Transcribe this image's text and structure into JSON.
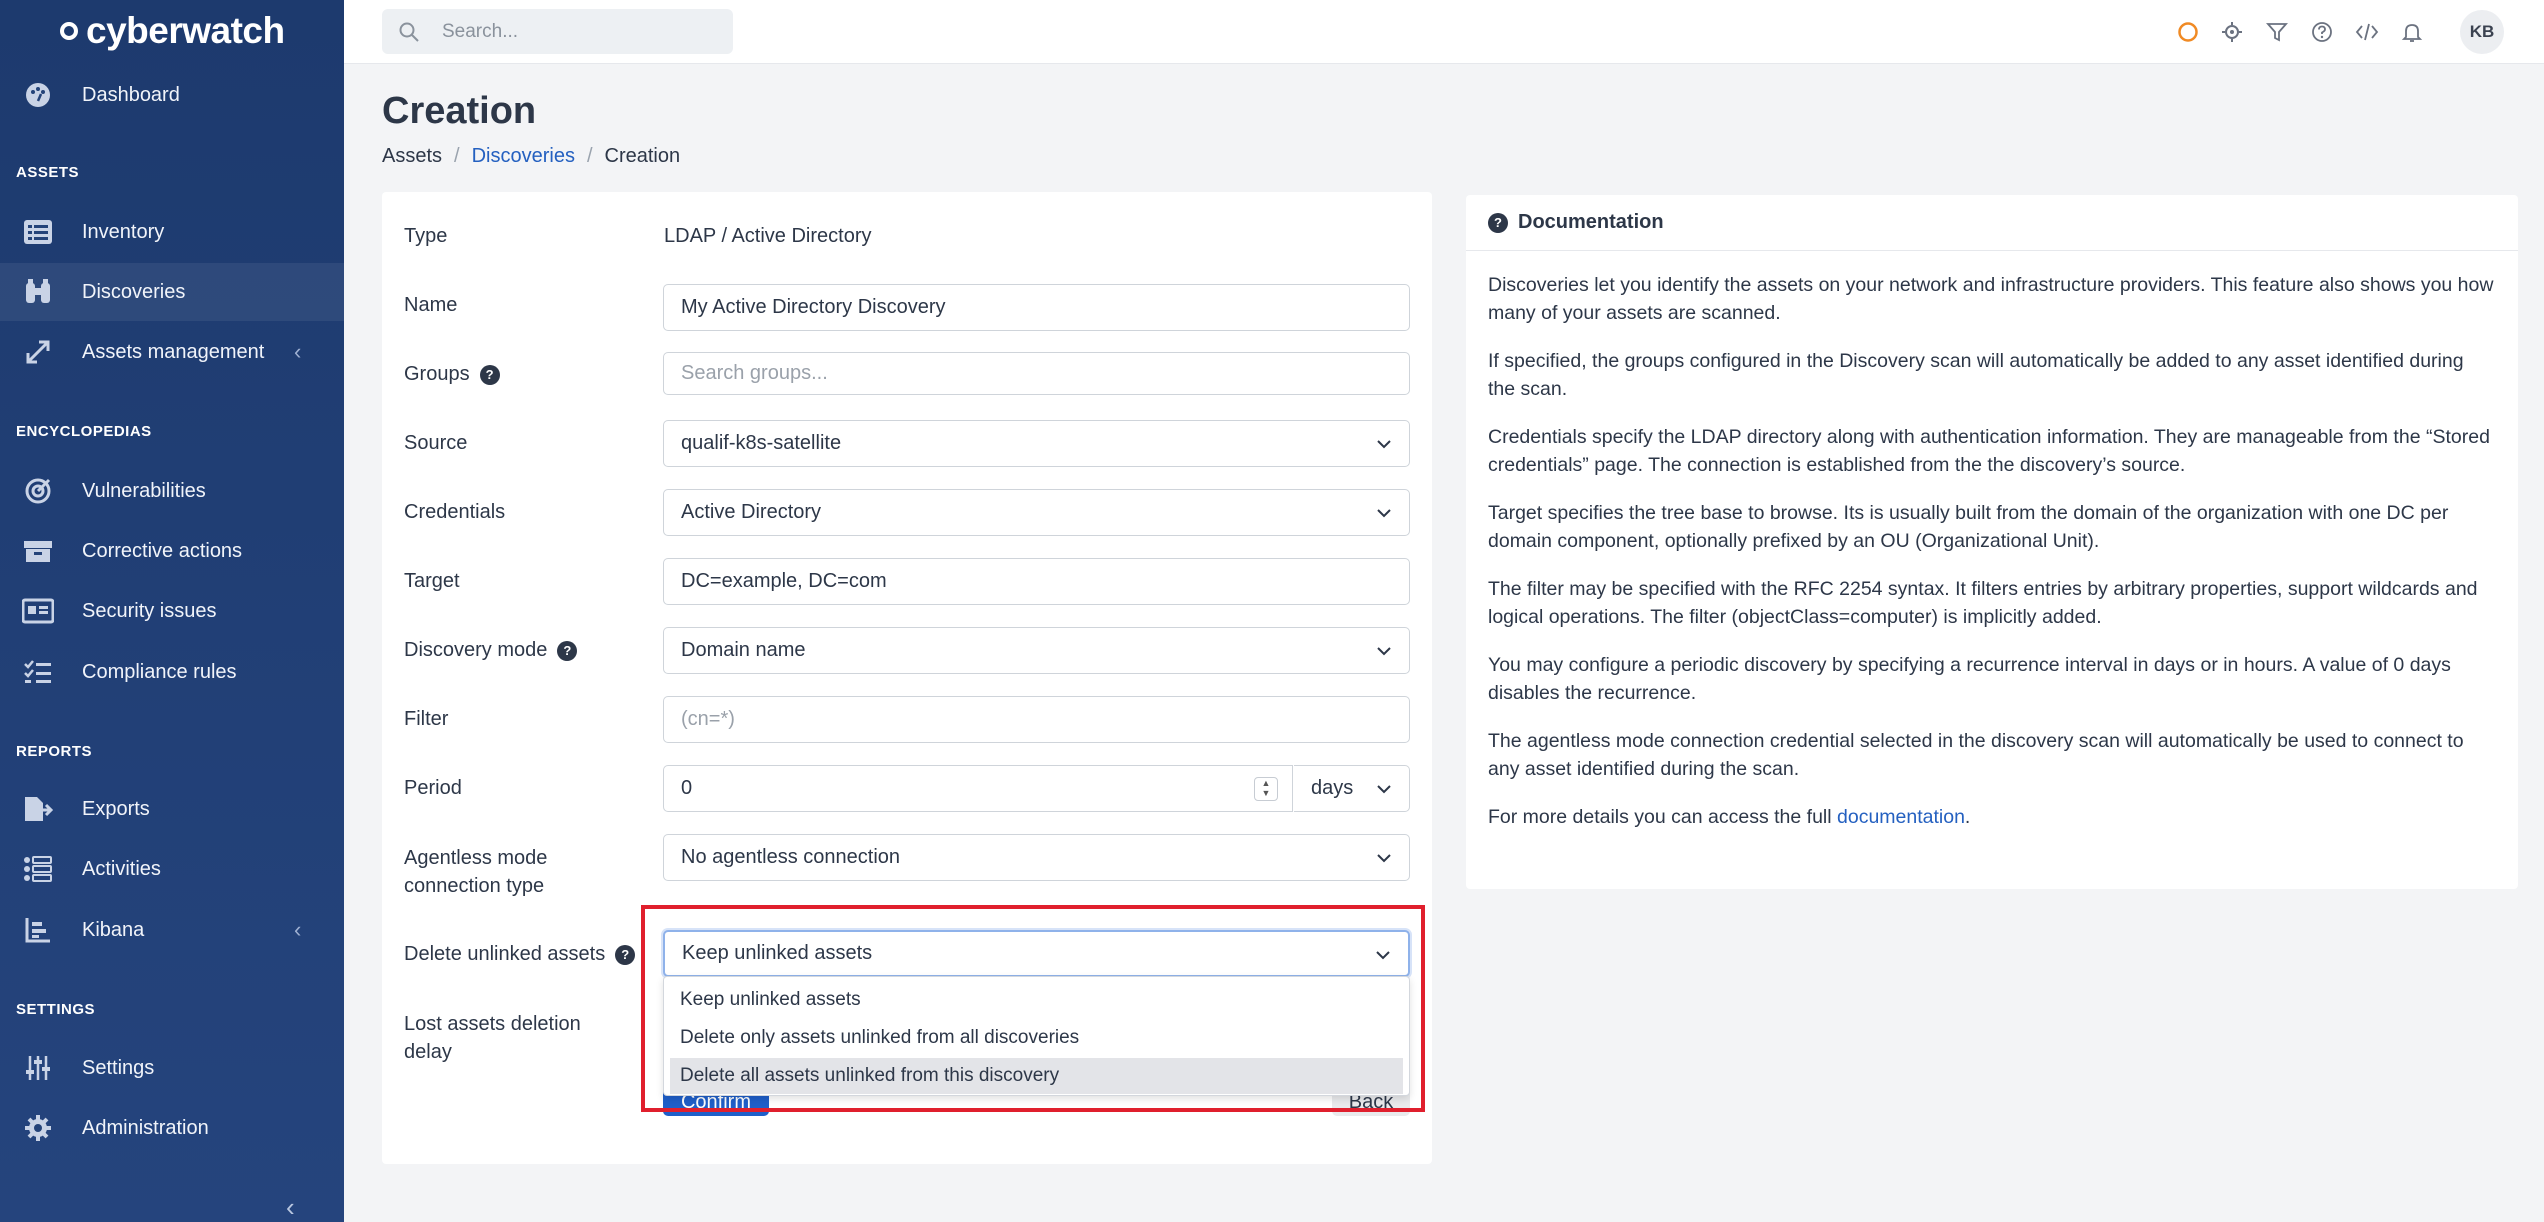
{
  "brand": {
    "name": "cyberwatch"
  },
  "sidebar": {
    "dashboard": "Dashboard",
    "sections": {
      "assets": "ASSETS",
      "encyclopedias": "ENCYCLOPEDIAS",
      "reports": "REPORTS",
      "settings": "SETTINGS"
    },
    "items": {
      "inventory": "Inventory",
      "discoveries": "Discoveries",
      "assets_management": "Assets management",
      "vulnerabilities": "Vulnerabilities",
      "corrective_actions": "Corrective actions",
      "security_issues": "Security issues",
      "compliance_rules": "Compliance rules",
      "exports": "Exports",
      "activities": "Activities",
      "kibana": "Kibana",
      "settings": "Settings",
      "administration": "Administration"
    }
  },
  "topbar": {
    "search_placeholder": "Search...",
    "avatar": "KB",
    "status_color": "#f08a24"
  },
  "page": {
    "title": "Creation",
    "breadcrumb": {
      "assets": "Assets",
      "discoveries": "Discoveries",
      "current": "Creation"
    }
  },
  "form": {
    "type_label": "Type",
    "type_value": "LDAP / Active Directory",
    "name_label": "Name",
    "name_value": "My Active Directory Discovery",
    "groups_label": "Groups",
    "groups_placeholder": "Search groups...",
    "source_label": "Source",
    "source_value": "qualif-k8s-satellite",
    "credentials_label": "Credentials",
    "credentials_value": "Active Directory",
    "target_label": "Target",
    "target_value": "DC=example, DC=com",
    "discovery_mode_label": "Discovery mode",
    "discovery_mode_value": "Domain name",
    "filter_label": "Filter",
    "filter_placeholder": "(cn=*)",
    "period_label": "Period",
    "period_value": "0",
    "period_unit": "days",
    "agentless_label_1": "Agentless mode",
    "agentless_label_2": "connection type",
    "agentless_value": "No agentless connection",
    "delete_label": "Delete unlinked assets",
    "delete_value": "Keep unlinked assets",
    "delete_options": [
      "Keep unlinked assets",
      "Delete only assets unlinked from all discoveries",
      "Delete all assets unlinked from this discovery"
    ],
    "lost_label_1": "Lost assets deletion",
    "lost_label_2": "delay",
    "confirm": "Confirm",
    "back": "Back"
  },
  "documentation": {
    "title": "Documentation",
    "paragraphs": [
      "Discoveries let you identify the assets on your network and infrastructure providers. This feature also shows you how many of your assets are scanned.",
      "If specified, the groups configured in the Discovery scan will automatically be added to any asset identified during the scan.",
      "Credentials specify the LDAP directory along with authentication information. They are manageable from the “Stored credentials” page. The connection is established from the the discovery’s source.",
      "Target specifies the tree base to browse. Its is usually built from the domain of the organization with one DC per domain component, optionally prefixed by an OU (Organizational Unit).",
      "The filter may be specified with the RFC 2254 syntax. It filters entries by arbitrary properties, support wildcards and logical operations. The filter (objectClass=computer) is implicitly added.",
      "You may configure a periodic discovery by specifying a recurrence interval in days or in hours. A value of 0 days disables the recurrence.",
      "The agentless mode connection credential selected in the discovery scan will automatically be used to connect to any asset identified during the scan."
    ],
    "more_prefix": "For more details you can access the full ",
    "more_link": "documentation",
    "more_suffix": "."
  }
}
